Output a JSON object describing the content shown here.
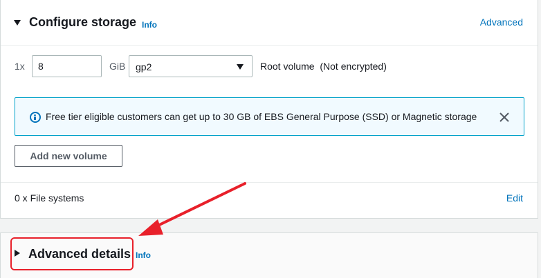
{
  "storage_section": {
    "title": "Configure storage",
    "info_label": "Info",
    "advanced_link": "Advanced"
  },
  "volume_row": {
    "multiplier": "1x",
    "size_value": "8",
    "size_unit": "GiB",
    "volume_type": "gp2",
    "root_label": "Root volume  (Not encrypted)"
  },
  "alert": {
    "icon": "info-circle-icon",
    "text": "Free tier eligible customers can get up to 30 GB of EBS General Purpose (SSD) or Magnetic storage",
    "close_icon": "close-icon"
  },
  "add_volume_button": "Add new volume",
  "file_systems": {
    "label": "0 x File systems",
    "edit_link": "Edit"
  },
  "advanced_details": {
    "title": "Advanced details",
    "info_label": "Info"
  },
  "colors": {
    "link": "#0073bb",
    "alert_border": "#00a1c9",
    "alert_bg": "#f1faff",
    "annotation": "#e8202a"
  }
}
